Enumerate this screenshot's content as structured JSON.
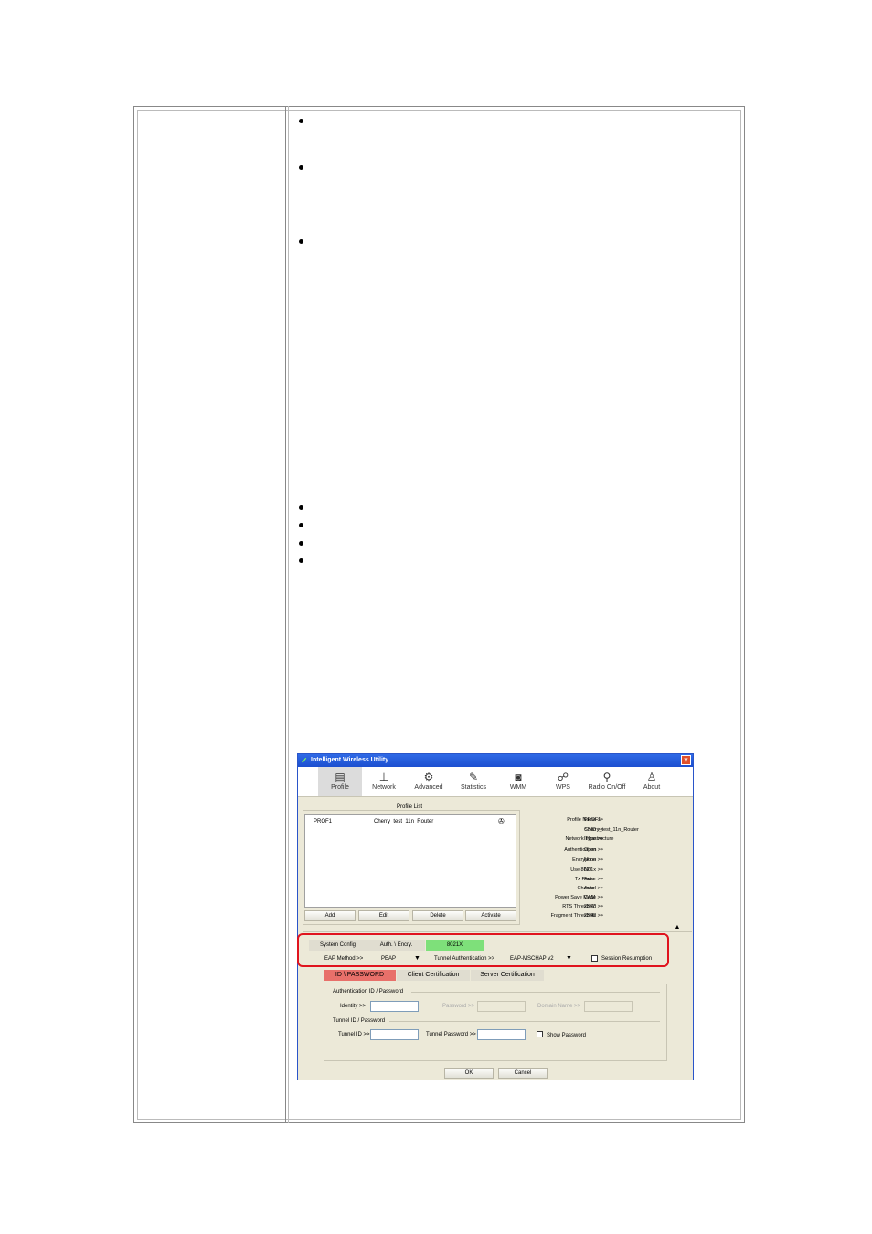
{
  "window": {
    "title": "Intelligent Wireless Utility",
    "toolbar": [
      {
        "label": "Profile",
        "icon": "profile-icon",
        "glyph": "▤"
      },
      {
        "label": "Network",
        "icon": "network-icon",
        "glyph": "⊥"
      },
      {
        "label": "Advanced",
        "icon": "advanced-icon",
        "glyph": "⚙"
      },
      {
        "label": "Statistics",
        "icon": "statistics-icon",
        "glyph": "✎"
      },
      {
        "label": "WMM",
        "icon": "wmm-icon",
        "glyph": "◙"
      },
      {
        "label": "WPS",
        "icon": "wps-icon",
        "glyph": "☍"
      },
      {
        "label": "Radio On/Off",
        "icon": "radio-icon",
        "glyph": "⚲"
      },
      {
        "label": "About",
        "icon": "about-icon",
        "glyph": "♙"
      }
    ],
    "profile_list_title": "Profile List",
    "profile_row": {
      "name": "PROF1",
      "ssid": "Cherry_test_11n_Router"
    },
    "buttons": {
      "add": "Add",
      "edit": "Edit",
      "delete": "Delete",
      "activate": "Activate"
    },
    "info_labels": [
      "Profile Name >>",
      "SSID >>",
      "Network Type >>",
      "Authentication >>",
      "Encryption >>",
      "Use 802.1x >>",
      "Tx Power >>",
      "Channel >>",
      "Power Save Mode >>",
      "RTS Threshold >>",
      "Fragment Threshold >>"
    ],
    "info_values": [
      "PROF1",
      "Cherry_test_11n_Router",
      "Infrastructure",
      "Open",
      "None",
      "NO",
      "Auto",
      "Auto",
      "CAM",
      "2347",
      "2346"
    ],
    "config_tabs": [
      "System Config",
      "Auth. \\ Encry.",
      "8021X"
    ],
    "eap_method_label": "EAP Method >>",
    "eap_method_value": "PEAP",
    "tunnel_auth_label": "Tunnel Authentication >>",
    "tunnel_auth_value": "EAP-MSCHAP v2",
    "session_resumption": "Session Resumption",
    "cert_tabs": [
      "ID \\ PASSWORD",
      "Client Certification",
      "Server Certification"
    ],
    "auth_group": "Authentication ID / Password",
    "identity_label": "Identity >>",
    "password_label": "Password >>",
    "domain_label": "Domain Name >>",
    "tunnel_group": "Tunnel ID / Password",
    "tunnel_id_label": "Tunnel ID >>",
    "tunnel_password_label": "Tunnel Password >>",
    "show_password": "Show Password",
    "ok": "OK",
    "cancel": "Cancel",
    "colors": {
      "title_bar": "#1c4fd0",
      "active_8021x": "#7ee07a",
      "active_idpw": "#e8706a",
      "highlight_box": "#e0141e"
    }
  }
}
